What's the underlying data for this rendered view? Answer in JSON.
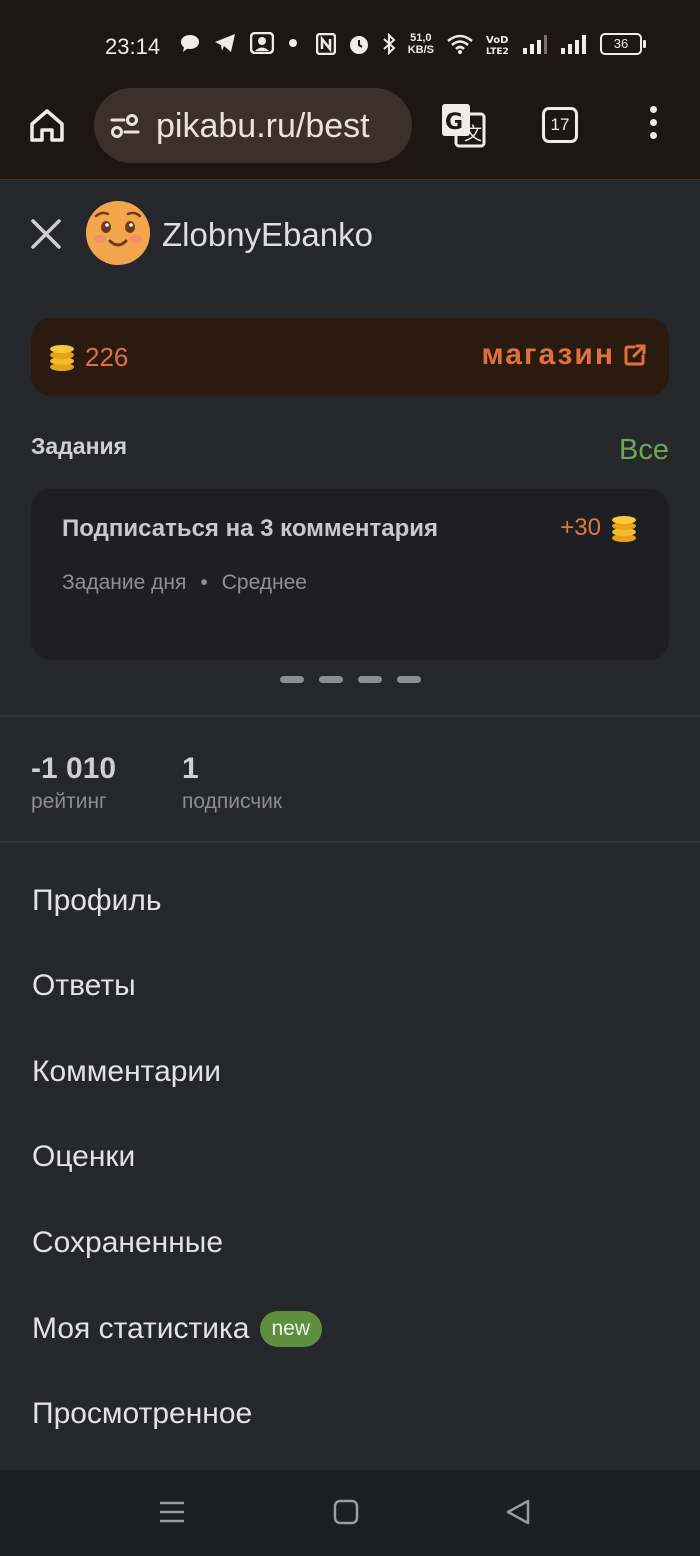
{
  "status_bar": {
    "time": "23:14",
    "net_speed_value": "51,0",
    "net_speed_unit": "KB/S",
    "battery": "36",
    "icons": [
      "chat-bubble-icon",
      "telegram-icon",
      "gallery-icon",
      "dot-icon",
      "nfc-icon",
      "alarm-icon",
      "bluetooth-icon",
      "wifi-icon",
      "volte-icon",
      "signal-icon",
      "signal-icon-2",
      "battery-icon"
    ]
  },
  "browser": {
    "url": "pikabu.ru/best",
    "tab_count": "17"
  },
  "profile": {
    "username": "ZlobnyEbanko"
  },
  "wallet": {
    "coins": "226",
    "shop_label": "магазин"
  },
  "tasks": {
    "title": "Задания",
    "all_label": "Все",
    "card": {
      "title": "Подписаться на 3 комментария",
      "reward": "+30",
      "type": "Задание дня",
      "difficulty": "Среднее"
    },
    "pager_count": 4
  },
  "stats": [
    {
      "value": "-1 010",
      "label": "рейтинг"
    },
    {
      "value": "1",
      "label": "подписчик"
    }
  ],
  "menu": [
    {
      "label": "Профиль"
    },
    {
      "label": "Ответы"
    },
    {
      "label": "Комментарии"
    },
    {
      "label": "Оценки"
    },
    {
      "label": "Сохраненные"
    },
    {
      "label": "Моя статистика",
      "badge": "new"
    },
    {
      "label": "Просмотренное"
    }
  ],
  "colors": {
    "accent_orange": "#e0713a",
    "accent_green": "#6fa653",
    "background": "#26272b",
    "browser_bar": "#1e1612"
  }
}
